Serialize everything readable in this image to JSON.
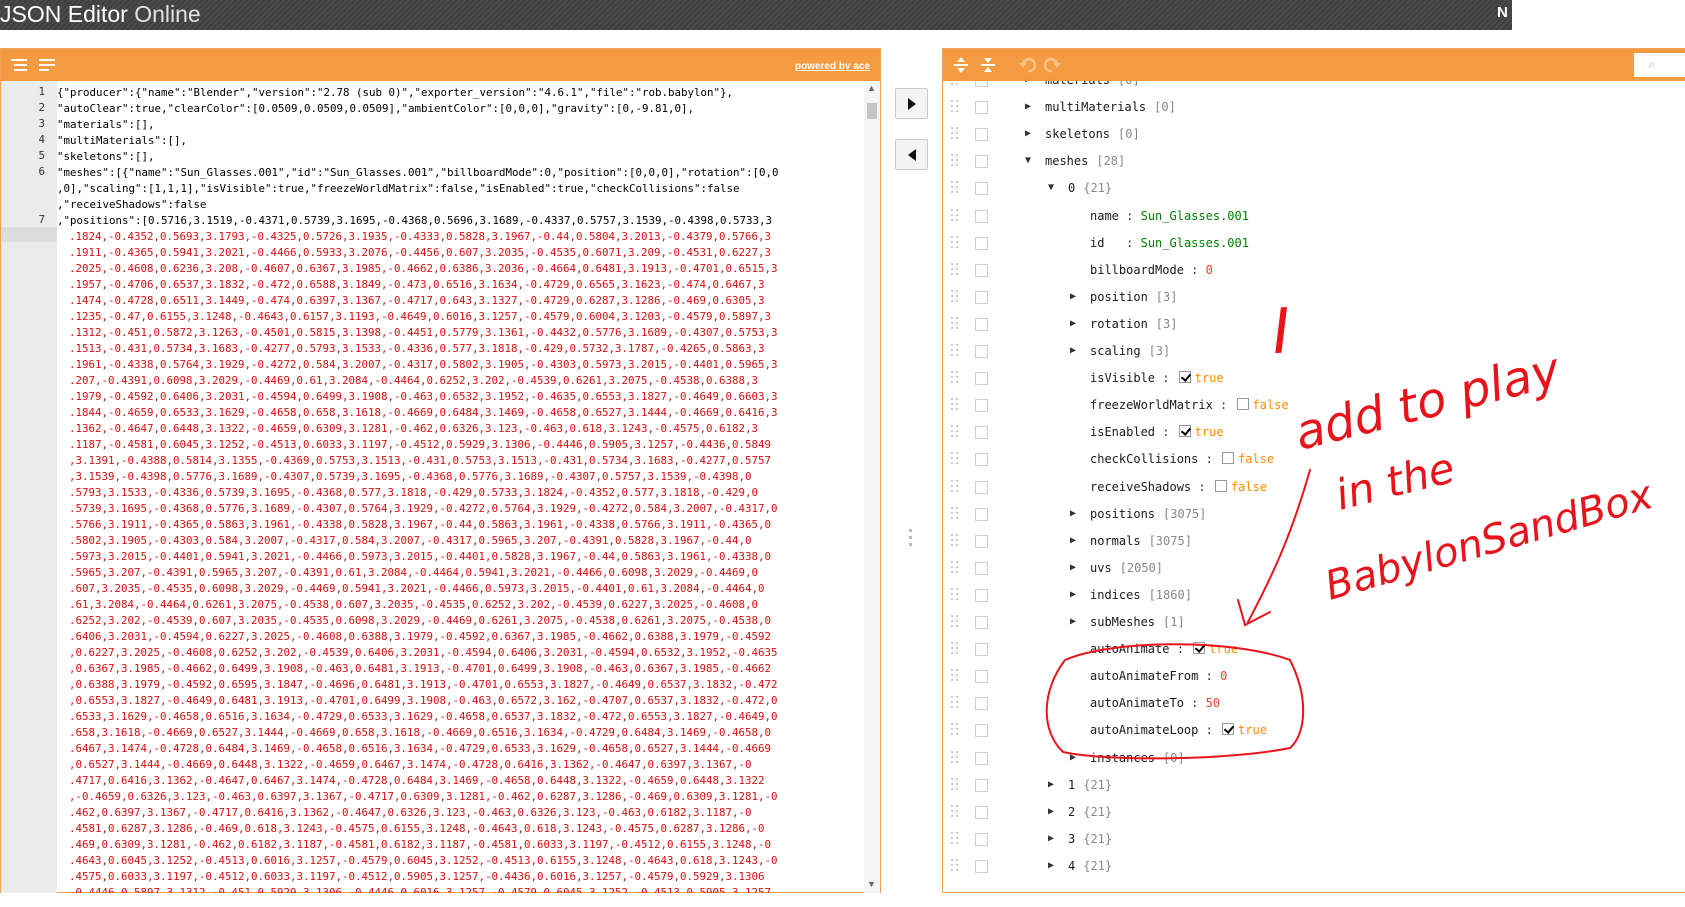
{
  "app": {
    "title_bold": "JSON Editor",
    "title_light": " Online",
    "top_right_text": "N"
  },
  "left_panel": {
    "powered_by": "powered by ace",
    "code_lines": [
      {
        "no": "1",
        "text": "{\"producer\":{\"name\":\"Blender\",\"version\":\"2.78 (sub 0)\",\"exporter_version\":\"4.6.1\",\"file\":\"rob.babylon\"},"
      },
      {
        "no": "2",
        "text": "\"autoClear\":true,\"clearColor\":[0.0509,0.0509,0.0509],\"ambientColor\":[0,0,0],\"gravity\":[0,-9.81,0],"
      },
      {
        "no": "3",
        "text": "\"materials\":[],"
      },
      {
        "no": "4",
        "text": "\"multiMaterials\":[],"
      },
      {
        "no": "5",
        "text": "\"skeletons\":[],"
      },
      {
        "no": "6",
        "text": "\"meshes\":[{\"name\":\"Sun_Glasses.001\",\"id\":\"Sun_Glasses.001\",\"billboardMode\":0,\"position\":[0,0,0],\"rotation\":[0,0"
      },
      {
        "no": "",
        "text": ",0],\"scaling\":[1,1,1],\"isVisible\":true,\"freezeWorldMatrix\":false,\"isEnabled\":true,\"checkCollisions\":false"
      },
      {
        "no": "",
        "text": ",\"receiveShadows\":false"
      },
      {
        "no": "7",
        "text": ",\"positions\":[0.5716,3.1519,-0.4371,0.5739,3.1695,-0.4368,0.5696,3.1689,-0.4337,0.5757,3.1539,-0.4398,0.5733,3"
      }
    ],
    "position_lines": [
      ".1824,-0.4352,0.5693,3.1793,-0.4325,0.5726,3.1935,-0.4333,0.5828,3.1967,-0.44,0.5804,3.2013,-0.4379,0.5766,3",
      ".1911,-0.4365,0.5941,3.2021,-0.4466,0.5933,3.2076,-0.4456,0.607,3.2035,-0.4535,0.6071,3.209,-0.4531,0.6227,3",
      ".2025,-0.4608,0.6236,3.208,-0.4607,0.6367,3.1985,-0.4662,0.6386,3.2036,-0.4664,0.6481,3.1913,-0.4701,0.6515,3",
      ".1957,-0.4706,0.6537,3.1832,-0.472,0.6588,3.1849,-0.473,0.6516,3.1634,-0.4729,0.6565,3.1623,-0.474,0.6467,3",
      ".1474,-0.4728,0.6511,3.1449,-0.474,0.6397,3.1367,-0.4717,0.643,3.1327,-0.4729,0.6287,3.1286,-0.469,0.6305,3",
      ".1235,-0.47,0.6155,3.1248,-0.4643,0.6157,3.1193,-0.4649,0.6016,3.1257,-0.4579,0.6004,3.1203,-0.4579,0.5897,3",
      ".1312,-0.451,0.5872,3.1263,-0.4501,0.5815,3.1398,-0.4451,0.5779,3.1361,-0.4432,0.5776,3.1689,-0.4307,0.5753,3",
      ".1513,-0.431,0.5734,3.1683,-0.4277,0.5793,3.1533,-0.4336,0.577,3.1818,-0.429,0.5732,3.1787,-0.4265,0.5863,3",
      ".1961,-0.4338,0.5764,3.1929,-0.4272,0.584,3.2007,-0.4317,0.5802,3.1905,-0.4303,0.5973,3.2015,-0.4401,0.5965,3",
      ".207,-0.4391,0.6098,3.2029,-0.4469,0.61,3.2084,-0.4464,0.6252,3.202,-0.4539,0.6261,3.2075,-0.4538,0.6388,3",
      ".1979,-0.4592,0.6406,3.2031,-0.4594,0.6499,3.1908,-0.463,0.6532,3.1952,-0.4635,0.6553,3.1827,-0.4649,0.6603,3",
      ".1844,-0.4659,0.6533,3.1629,-0.4658,0.658,3.1618,-0.4669,0.6484,3.1469,-0.4658,0.6527,3.1444,-0.4669,0.6416,3",
      ".1362,-0.4647,0.6448,3.1322,-0.4659,0.6309,3.1281,-0.462,0.6326,3.123,-0.463,0.618,3.1243,-0.4575,0.6182,3",
      ".1187,-0.4581,0.6045,3.1252,-0.4513,0.6033,3.1197,-0.4512,0.5929,3.1306,-0.4446,0.5905,3.1257,-0.4436,0.5849",
      ",3.1391,-0.4388,0.5814,3.1355,-0.4369,0.5753,3.1513,-0.431,0.5753,3.1513,-0.431,0.5734,3.1683,-0.4277,0.5757",
      ",3.1539,-0.4398,0.5776,3.1689,-0.4307,0.5739,3.1695,-0.4368,0.5776,3.1689,-0.4307,0.5757,3.1539,-0.4398,0",
      ".5793,3.1533,-0.4336,0.5739,3.1695,-0.4368,0.577,3.1818,-0.429,0.5733,3.1824,-0.4352,0.577,3.1818,-0.429,0",
      ".5739,3.1695,-0.4368,0.5776,3.1689,-0.4307,0.5764,3.1929,-0.4272,0.5764,3.1929,-0.4272,0.584,3.2007,-0.4317,0",
      ".5766,3.1911,-0.4365,0.5863,3.1961,-0.4338,0.5828,3.1967,-0.44,0.5863,3.1961,-0.4338,0.5766,3.1911,-0.4365,0",
      ".5802,3.1905,-0.4303,0.584,3.2007,-0.4317,0.584,3.2007,-0.4317,0.5965,3.207,-0.4391,0.5828,3.1967,-0.44,0",
      ".5973,3.2015,-0.4401,0.5941,3.2021,-0.4466,0.5973,3.2015,-0.4401,0.5828,3.1967,-0.44,0.5863,3.1961,-0.4338,0",
      ".5965,3.207,-0.4391,0.5965,3.207,-0.4391,0.61,3.2084,-0.4464,0.5941,3.2021,-0.4466,0.6098,3.2029,-0.4469,0",
      ".607,3.2035,-0.4535,0.6098,3.2029,-0.4469,0.5941,3.2021,-0.4466,0.5973,3.2015,-0.4401,0.61,3.2084,-0.4464,0",
      ".61,3.2084,-0.4464,0.6261,3.2075,-0.4538,0.607,3.2035,-0.4535,0.6252,3.202,-0.4539,0.6227,3.2025,-0.4608,0",
      ".6252,3.202,-0.4539,0.607,3.2035,-0.4535,0.6098,3.2029,-0.4469,0.6261,3.2075,-0.4538,0.6261,3.2075,-0.4538,0",
      ".6406,3.2031,-0.4594,0.6227,3.2025,-0.4608,0.6388,3.1979,-0.4592,0.6367,3.1985,-0.4662,0.6388,3.1979,-0.4592",
      ",0.6227,3.2025,-0.4608,0.6252,3.202,-0.4539,0.6406,3.2031,-0.4594,0.6406,3.2031,-0.4594,0.6532,3.1952,-0.4635",
      ",0.6367,3.1985,-0.4662,0.6499,3.1908,-0.463,0.6481,3.1913,-0.4701,0.6499,3.1908,-0.463,0.6367,3.1985,-0.4662",
      ",0.6388,3.1979,-0.4592,0.6595,3.1847,-0.4696,0.6481,3.1913,-0.4701,0.6553,3.1827,-0.4649,0.6537,3.1832,-0.472",
      ",0.6553,3.1827,-0.4649,0.6481,3.1913,-0.4701,0.6499,3.1908,-0.463,0.6572,3.162,-0.4707,0.6537,3.1832,-0.472,0",
      ".6533,3.1629,-0.4658,0.6516,3.1634,-0.4729,0.6533,3.1629,-0.4658,0.6537,3.1832,-0.472,0.6553,3.1827,-0.4649,0",
      ".658,3.1618,-0.4669,0.6527,3.1444,-0.4669,0.658,3.1618,-0.4669,0.6516,3.1634,-0.4729,0.6484,3.1469,-0.4658,0",
      ".6467,3.1474,-0.4728,0.6484,3.1469,-0.4658,0.6516,3.1634,-0.4729,0.6533,3.1629,-0.4658,0.6527,3.1444,-0.4669",
      ",0.6527,3.1444,-0.4669,0.6448,3.1322,-0.4659,0.6467,3.1474,-0.4728,0.6416,3.1362,-0.4647,0.6397,3.1367,-0",
      ".4717,0.6416,3.1362,-0.4647,0.6467,3.1474,-0.4728,0.6484,3.1469,-0.4658,0.6448,3.1322,-0.4659,0.6448,3.1322",
      ",-0.4659,0.6326,3.123,-0.463,0.6397,3.1367,-0.4717,0.6309,3.1281,-0.462,0.6287,3.1286,-0.469,0.6309,3.1281,-0",
      ".462,0.6397,3.1367,-0.4717,0.6416,3.1362,-0.4647,0.6326,3.123,-0.463,0.6326,3.123,-0.463,0.6182,3.1187,-0",
      ".4581,0.6287,3.1286,-0.469,0.618,3.1243,-0.4575,0.6155,3.1248,-0.4643,0.618,3.1243,-0.4575,0.6287,3.1286,-0",
      ".469,0.6309,3.1281,-0.462,0.6182,3.1187,-0.4581,0.6182,3.1187,-0.4581,0.6033,3.1197,-0.4512,0.6155,3.1248,-0",
      ".4643,0.6045,3.1252,-0.4513,0.6016,3.1257,-0.4579,0.6045,3.1252,-0.4513,0.6155,3.1248,-0.4643,0.618,3.1243,-0",
      ".4575,0.6033,3.1197,-0.4512,0.6033,3.1197,-0.4512,0.5905,3.1257,-0.4436,0.6016,3.1257,-0.4579,0.5929,3.1306",
      "-0.4446,0.5897,3.1312,-0.451,0.5929,3.1306,-0.4446,0.6016,3.1257,-0.4579,0.6045,3.1252,-0.4513,0.5905,3.1257"
    ]
  },
  "tree": [
    {
      "indent": 0,
      "exp": "▶",
      "key": "materials",
      "count": "[0]"
    },
    {
      "indent": 0,
      "exp": "▶",
      "key": "multiMaterials",
      "count": "[0]"
    },
    {
      "indent": 0,
      "exp": "▶",
      "key": "skeletons",
      "count": "[0]"
    },
    {
      "indent": 0,
      "exp": "▼",
      "key": "meshes",
      "count": "[28]"
    },
    {
      "indent": 1,
      "exp": "▼",
      "key": "0",
      "count": "{21}"
    },
    {
      "indent": 2,
      "exp": "",
      "key": "name",
      "sep": " : ",
      "type": "s",
      "value": "Sun_Glasses.001"
    },
    {
      "indent": 2,
      "exp": "",
      "key": "id  ",
      "sep": " : ",
      "type": "s",
      "value": "Sun_Glasses.001"
    },
    {
      "indent": 2,
      "exp": "",
      "key": "billboardMode",
      "sep": " : ",
      "type": "n",
      "value": "0"
    },
    {
      "indent": 2,
      "exp": "▶",
      "key": "position",
      "count": "[3]"
    },
    {
      "indent": 2,
      "exp": "▶",
      "key": "rotation",
      "count": "[3]"
    },
    {
      "indent": 2,
      "exp": "▶",
      "key": "scaling",
      "count": "[3]"
    },
    {
      "indent": 2,
      "exp": "",
      "key": "isVisible",
      "sep": " : ",
      "type": "b",
      "checked": true,
      "value": "true"
    },
    {
      "indent": 2,
      "exp": "",
      "key": "freezeWorldMatrix",
      "sep": " : ",
      "type": "b",
      "checked": false,
      "value": "false"
    },
    {
      "indent": 2,
      "exp": "",
      "key": "isEnabled",
      "sep": " : ",
      "type": "b",
      "checked": true,
      "value": "true"
    },
    {
      "indent": 2,
      "exp": "",
      "key": "checkCollisions",
      "sep": " : ",
      "type": "b",
      "checked": false,
      "value": "false"
    },
    {
      "indent": 2,
      "exp": "",
      "key": "receiveShadows",
      "sep": " : ",
      "type": "b",
      "checked": false,
      "value": "false"
    },
    {
      "indent": 2,
      "exp": "▶",
      "key": "positions",
      "count": "[3075]"
    },
    {
      "indent": 2,
      "exp": "▶",
      "key": "normals",
      "count": "[3075]"
    },
    {
      "indent": 2,
      "exp": "▶",
      "key": "uvs",
      "count": "[2050]"
    },
    {
      "indent": 2,
      "exp": "▶",
      "key": "indices",
      "count": "[1860]"
    },
    {
      "indent": 2,
      "exp": "▶",
      "key": "subMeshes",
      "count": "[1]"
    },
    {
      "indent": 2,
      "exp": "",
      "key": "autoAnimate",
      "sep": " : ",
      "type": "b",
      "checked": true,
      "value": "true"
    },
    {
      "indent": 2,
      "exp": "",
      "key": "autoAnimateFrom",
      "sep": " : ",
      "type": "n",
      "value": "0"
    },
    {
      "indent": 2,
      "exp": "",
      "key": "autoAnimateTo",
      "sep": " : ",
      "type": "n",
      "value": "50"
    },
    {
      "indent": 2,
      "exp": "",
      "key": "autoAnimateLoop",
      "sep": " : ",
      "type": "b",
      "checked": true,
      "value": "true"
    },
    {
      "indent": 2,
      "exp": "▶",
      "key": "instances",
      "count": "[0]"
    },
    {
      "indent": 1,
      "exp": "▶",
      "key": "1",
      "count": "{21}"
    },
    {
      "indent": 1,
      "exp": "▶",
      "key": "2",
      "count": "{21}"
    },
    {
      "indent": 1,
      "exp": "▶",
      "key": "3",
      "count": "{21}"
    },
    {
      "indent": 1,
      "exp": "▶",
      "key": "4",
      "count": "{21}"
    }
  ],
  "annotation": {
    "color": "#e8141c",
    "line1": "I",
    "line2": "add to play",
    "line3": "in the",
    "line4": "BabylonSandBox"
  },
  "colors": {
    "accent": "#f49b42",
    "topbar": "#454545"
  }
}
